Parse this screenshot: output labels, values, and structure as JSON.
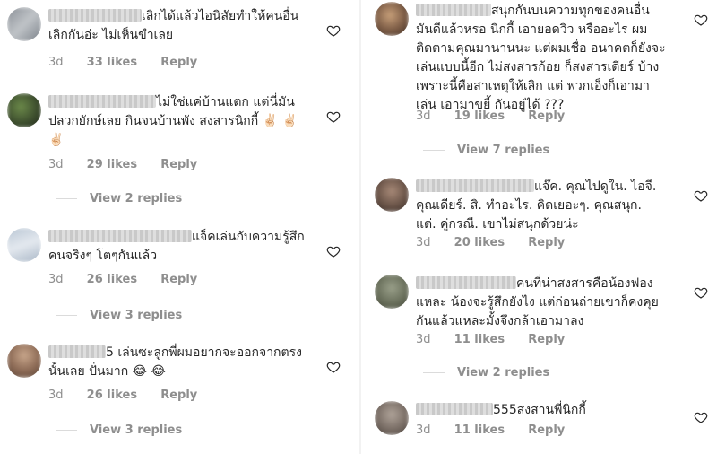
{
  "left_comments": [
    {
      "lines": [
        "เลิกได้แล้วไอนิสัยทำให้คนอื่น",
        "เลิกกันอ่ะ ไม่เห็นขำเลย"
      ],
      "time": "3d",
      "likes": "33 likes",
      "reply": "Reply",
      "view_replies": ""
    },
    {
      "lines": [
        "ไม่ใช่แค่บ้านแตก แต่นี่มัน",
        "ปลวกยักษ์เลย กินจนบ้านพัง สงสารนิกกี้ ✌🏻 ✌🏻",
        "✌🏻"
      ],
      "time": "3d",
      "likes": "29 likes",
      "reply": "Reply",
      "view_replies": "View 2 replies"
    },
    {
      "lines": [
        "แจ็คเล่นกับความรู้สึก",
        "คนจริงๆ โตๆกันแล้ว"
      ],
      "time": "3d",
      "likes": "26 likes",
      "reply": "Reply",
      "view_replies": "View 3 replies"
    },
    {
      "lines": [
        "5 เล่นซะลูกพี่ผมอยากจะออกจากตรง",
        "นั้นเลย ปั่นมาก 😂 😂"
      ],
      "time": "3d",
      "likes": "26 likes",
      "reply": "Reply",
      "view_replies": "View 3 replies"
    }
  ],
  "right_comments": [
    {
      "lines": [
        "สนุกกันบนความทุกของคนอื่น",
        "มันดีแล้วหรอ นิกกี้ เอายอดวิว หรืออะไร ผม",
        "ติดตามคุณมานานนะ แต่ผมเชื่อ อนาคตก็ยังจะ",
        "เล่นแบบนี้อีก ไม่สงสารก้อย ก็สงสารเดียร์ บ้าง",
        "เพราะนี้คือสาเหตุให้เลิก แต่ พวกเอ็งก็เอามา",
        "เล่น เอามาขยี้ กันอยู่ได้ ???"
      ],
      "time": "3d",
      "likes": "19 likes",
      "reply": "Reply",
      "view_replies": "View 7 replies"
    },
    {
      "lines": [
        "แจ๊ค. คุณไปดูใน. ไอจี.",
        "คุณเดียร์. สิ. ทำอะไร. คิดเยอะๆ. คุณสนุก.",
        "แต่. คู่กรณี. เขาไม่สนุกด้วยน่ะ"
      ],
      "time": "3d",
      "likes": "20 likes",
      "reply": "Reply",
      "view_replies": ""
    },
    {
      "lines": [
        "คนที่น่าสงสารคือน้องฟอง",
        "แหละ  น้องจะรู้สึกยังไง แต่ก่อนถ่ายเขาก็คงคุย",
        "กันแล้วแหละมั้งจึงกล้าเอามาลง"
      ],
      "time": "3d",
      "likes": "11 likes",
      "reply": "Reply",
      "view_replies": "View 2 replies"
    },
    {
      "lines": [
        "555สงสานพี่นิกกี้"
      ],
      "time": "3d",
      "likes": "11 likes",
      "reply": "Reply",
      "view_replies": ""
    }
  ],
  "colors": {
    "text": "#262626",
    "meta": "#8e8e8e",
    "line": "#dbdbdb"
  },
  "icons": {
    "like": "heart-outline-icon"
  }
}
